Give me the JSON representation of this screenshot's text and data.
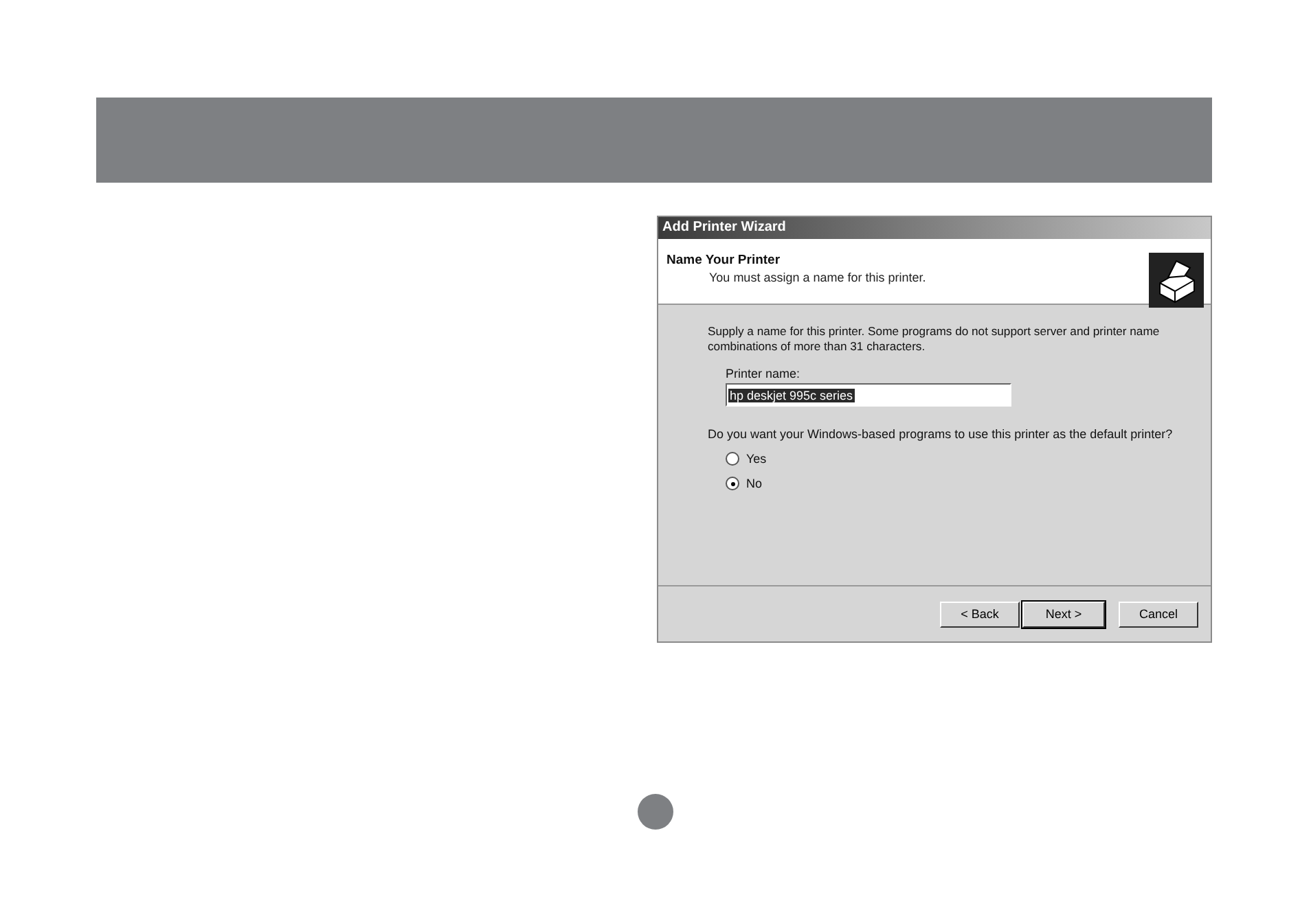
{
  "dialog": {
    "title": "Add Printer Wizard",
    "header": {
      "title": "Name Your Printer",
      "subtitle": "You must assign a name for this printer."
    },
    "description": "Supply a name for this printer. Some programs do not support server and printer name combinations of more than 31 characters.",
    "name_field": {
      "label": "Printer name:",
      "value": "hp deskjet 995c series",
      "selected": true
    },
    "question": "Do you want your Windows-based programs to use this printer as the default printer?",
    "options": [
      {
        "label": "Yes",
        "selected": false
      },
      {
        "label": "No",
        "selected": true
      }
    ],
    "buttons": [
      {
        "label": "< Back",
        "default": false
      },
      {
        "label": "Next >",
        "default": true
      },
      {
        "label": "Cancel",
        "default": false
      }
    ]
  }
}
